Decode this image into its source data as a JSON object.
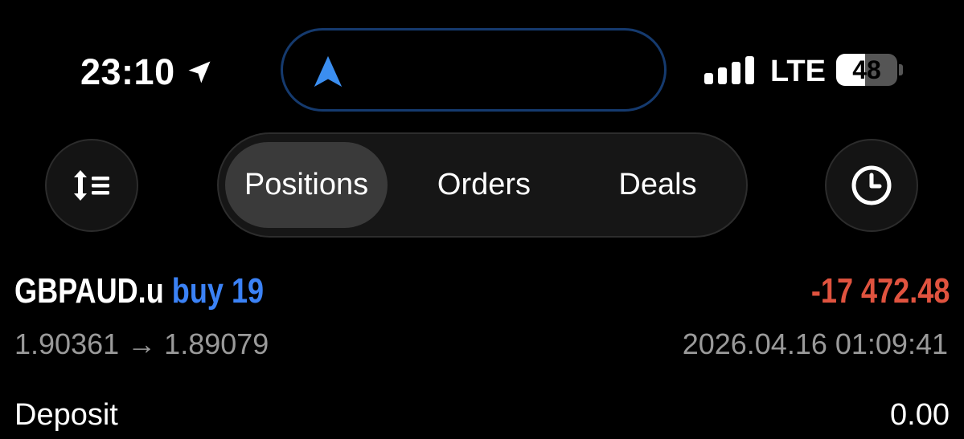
{
  "status_bar": {
    "time": "23:10",
    "network": "LTE",
    "battery_level": "48",
    "battery_fraction": 0.48,
    "signal_bars": 4,
    "icons": [
      "location-arrow-icon",
      "navigation-arrow-icon",
      "signal-icon",
      "battery-icon"
    ]
  },
  "toolbar": {
    "sort_icon": "sort-icon",
    "history_icon": "clock-icon",
    "tabs": [
      {
        "label": "Positions",
        "active": true
      },
      {
        "label": "Orders",
        "active": false
      },
      {
        "label": "Deals",
        "active": false
      }
    ]
  },
  "position": {
    "symbol": "GBPAUD.u",
    "side_volume": "buy 19",
    "profit": "-17 472.48",
    "open_price": "1.90361",
    "arrow": "→",
    "current_price": "1.89079",
    "datetime": "2026.04.16 01:09:41"
  },
  "deposit": {
    "label": "Deposit",
    "value": "0.00"
  },
  "colors": {
    "background": "#000000",
    "buy": "#3b82f6",
    "loss": "#e0533f",
    "secondary_text": "#9a9a9a",
    "island_border": "#153a6e"
  }
}
